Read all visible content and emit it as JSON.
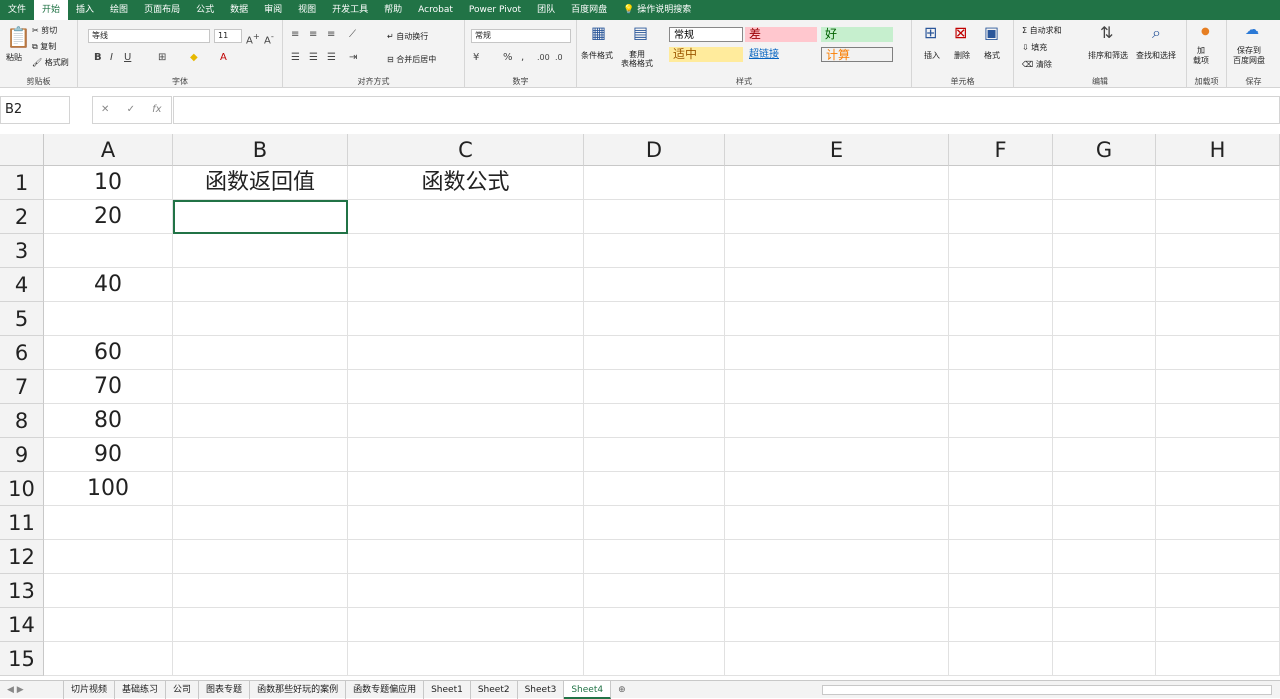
{
  "ribbon_tabs": [
    "文件",
    "开始",
    "插入",
    "绘图",
    "页面布局",
    "公式",
    "数据",
    "审阅",
    "视图",
    "开发工具",
    "帮助",
    "Acrobat",
    "Power Pivot",
    "团队",
    "百度网盘"
  ],
  "tell_me": "操作说明搜索",
  "clipboard": {
    "paste": "粘贴",
    "cut": "剪切",
    "copy": "复制",
    "format_painter": "格式刷",
    "label": "剪贴板"
  },
  "font": {
    "name": "等线",
    "size": "11",
    "label": "字体"
  },
  "alignment": {
    "wrap": "自动换行",
    "merge": "合并后居中",
    "label": "对齐方式"
  },
  "number": {
    "format": "常规",
    "label": "数字"
  },
  "styles": {
    "conditional": "条件格式",
    "table_format": "套用\n表格格式",
    "label": "样式",
    "normal": "常规",
    "bad": "差",
    "good": "好",
    "neutral": "适中",
    "hyperlink": "超链接",
    "calc": "计算"
  },
  "cells": {
    "insert": "插入",
    "delete": "删除",
    "format": "格式",
    "label": "单元格"
  },
  "editing": {
    "autosum": "自动求和",
    "fill": "填充",
    "clear": "清除",
    "sort": "排序和筛选",
    "find": "查找和选择",
    "label": "编辑"
  },
  "addins": {
    "add": "加\n载项",
    "label": "加载项"
  },
  "save": {
    "save_to": "保存到\n百度网盘",
    "label": "保存"
  },
  "name_box": "B2",
  "columns": [
    "A",
    "B",
    "C",
    "D",
    "E",
    "F",
    "G",
    "H"
  ],
  "rows": [
    "1",
    "2",
    "3",
    "4",
    "5",
    "6",
    "7",
    "8",
    "9",
    "10",
    "11",
    "12",
    "13",
    "14",
    "15"
  ],
  "cells_data": {
    "A": [
      "10",
      "20",
      "",
      "40",
      "",
      "60",
      "70",
      "80",
      "90",
      "100",
      "",
      "",
      "",
      "",
      ""
    ],
    "B1": "函数返回值",
    "C1": "函数公式"
  },
  "sheet_tabs": [
    "切片视频",
    "基础练习",
    "公司",
    "图表专题",
    "函数那些好玩的案例",
    "函数专题偏应用",
    "Sheet1",
    "Sheet2",
    "Sheet3",
    "Sheet4"
  ],
  "active_sheet": "Sheet4",
  "colors": {
    "excel_green": "#217346",
    "bad_bg": "#ffc7ce",
    "bad_fg": "#9c0006",
    "good_bg": "#c6efce",
    "good_fg": "#006100",
    "neutral_bg": "#ffeb9c",
    "neutral_fg": "#9c5700",
    "calc_fg": "#fa7d00"
  }
}
